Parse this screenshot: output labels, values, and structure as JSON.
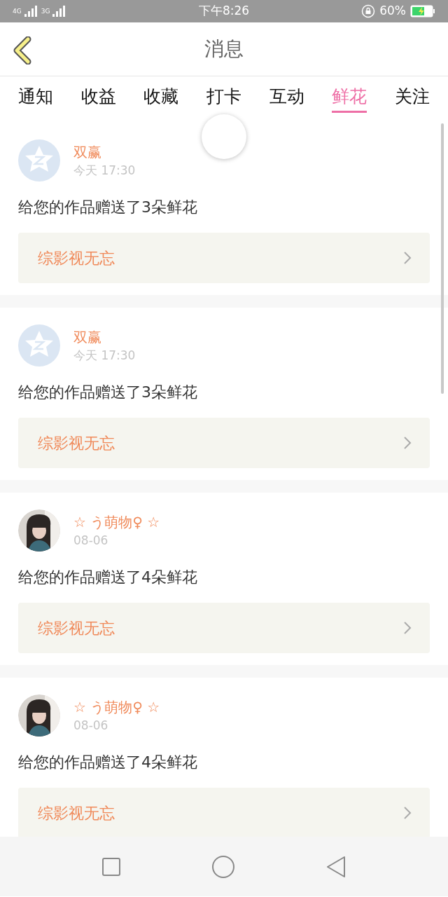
{
  "status_bar": {
    "network_1": "4G",
    "network_2": "3G",
    "time": "下午8:26",
    "battery": "60%"
  },
  "header": {
    "title": "消息"
  },
  "tabs": [
    {
      "label": "通知",
      "selected": false
    },
    {
      "label": "收益",
      "selected": false
    },
    {
      "label": "收藏",
      "selected": false
    },
    {
      "label": "打卡",
      "selected": false
    },
    {
      "label": "互动",
      "selected": false
    },
    {
      "label": "鲜花",
      "selected": true
    },
    {
      "label": "关注",
      "selected": false
    }
  ],
  "messages": [
    {
      "kind": "default",
      "name": "双赢",
      "time": "今天 17:30",
      "text": "给您的作品赠送了3朵鲜花",
      "work": "综影视无忘"
    },
    {
      "kind": "default",
      "name": "双赢",
      "time": "今天 17:30",
      "text": "给您的作品赠送了3朵鲜花",
      "work": "综影视无忘"
    },
    {
      "kind": "picture",
      "name": "☆ う萌物♀ ☆",
      "time": "08-06",
      "text": "给您的作品赠送了4朵鲜花",
      "work": "综影视无忘"
    },
    {
      "kind": "picture",
      "name": "☆ う萌物♀ ☆",
      "time": "08-06",
      "text": "给您的作品赠送了4朵鲜花",
      "work": "综影视无忘"
    }
  ]
}
